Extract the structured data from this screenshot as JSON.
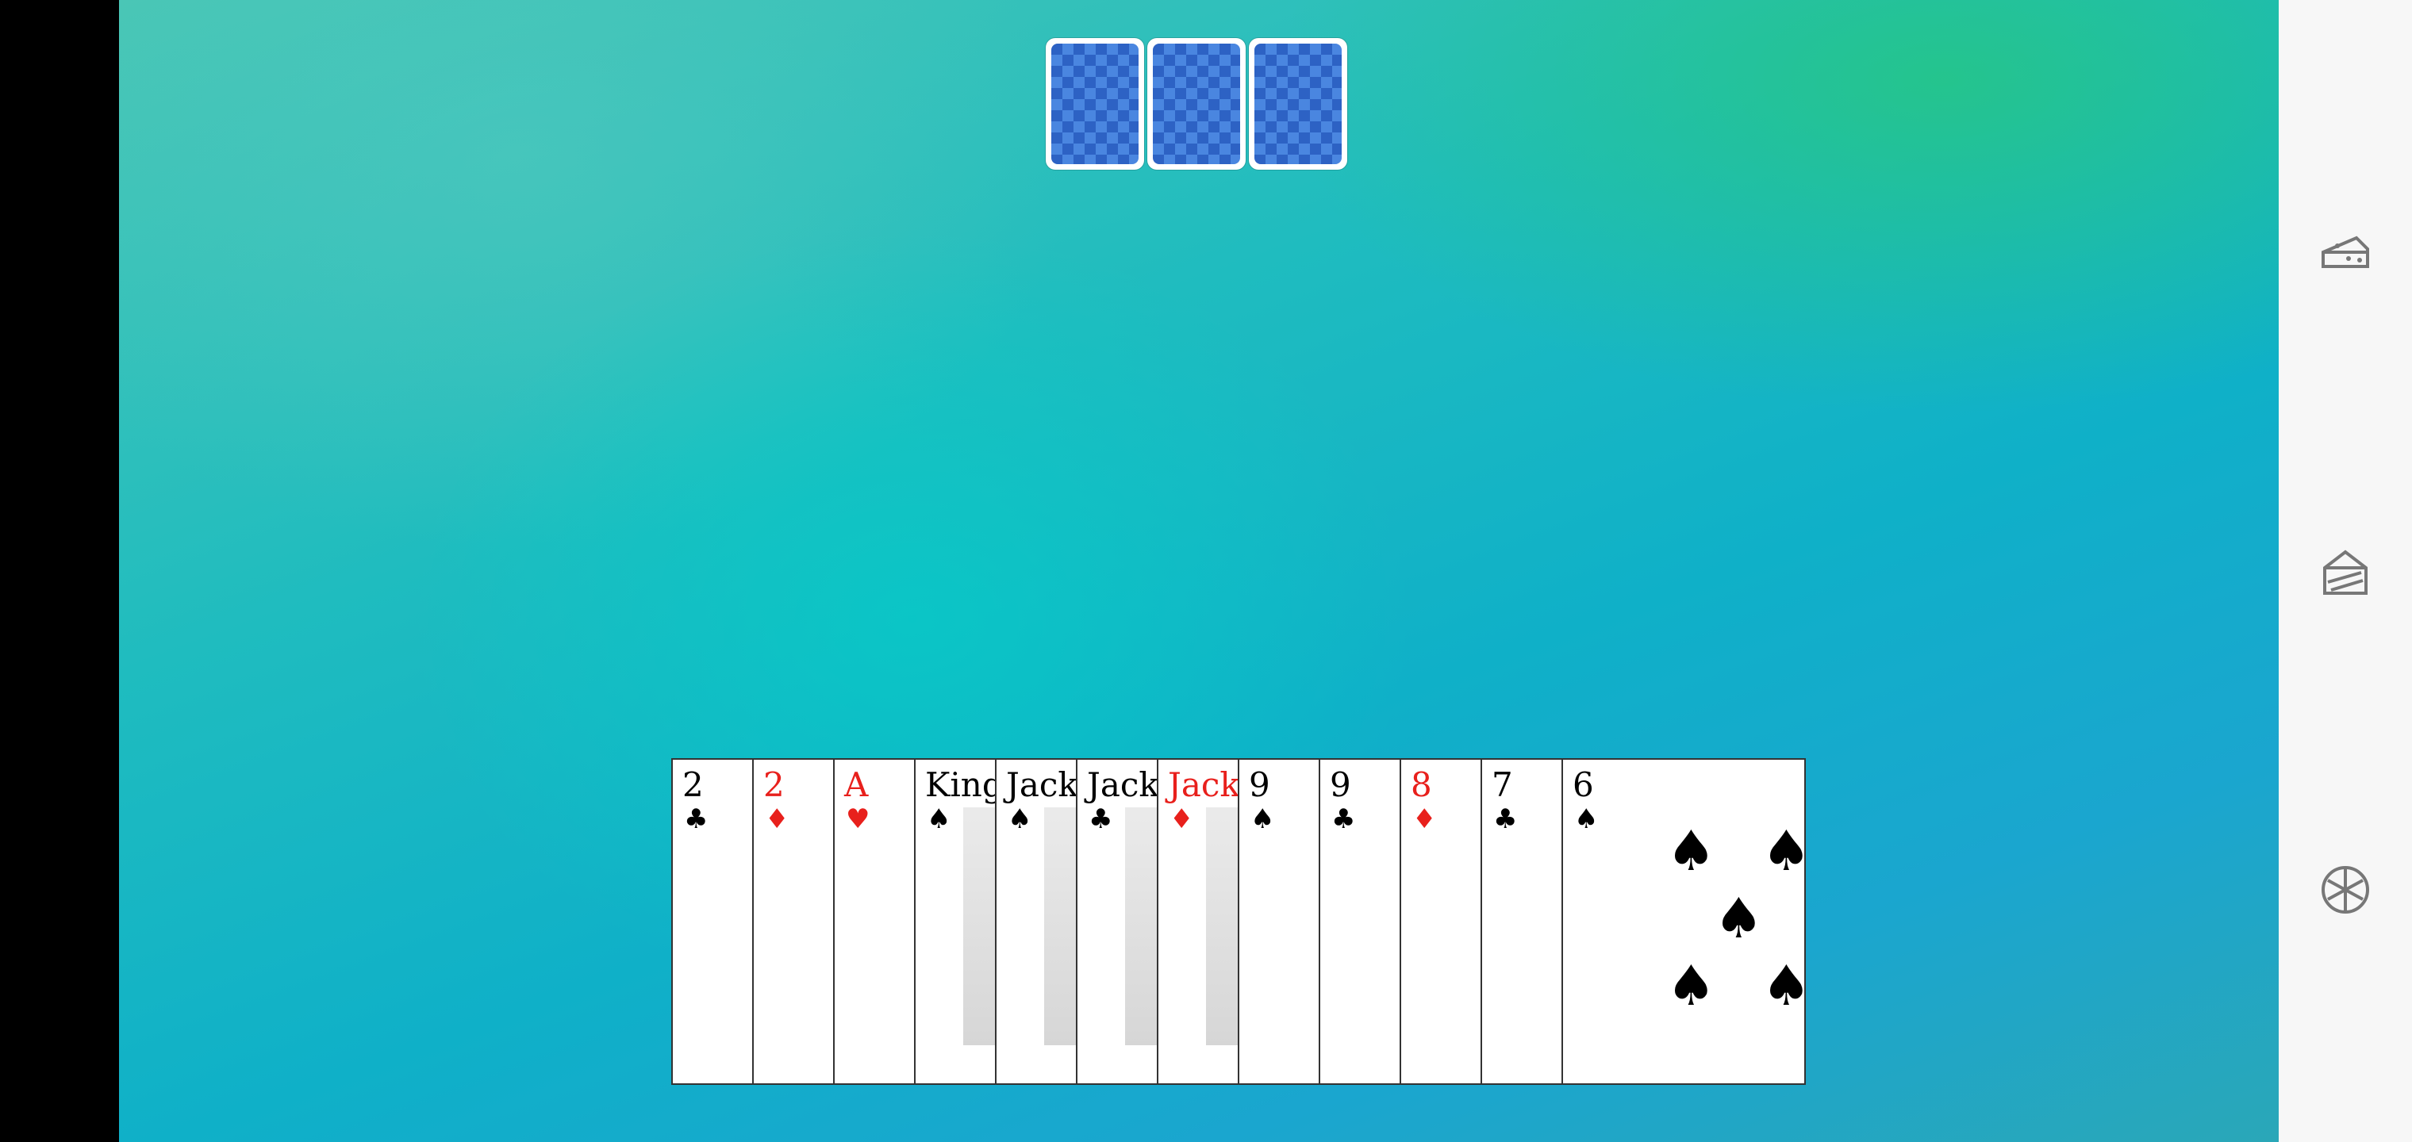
{
  "opponent_cards": {
    "count": 3,
    "back_color": "#2d62c4"
  },
  "hand": [
    {
      "rank": "2",
      "suit": "♣",
      "color": "black"
    },
    {
      "rank": "2",
      "suit": "♦",
      "color": "red"
    },
    {
      "rank": "A",
      "suit": "♥",
      "color": "red"
    },
    {
      "rank": "King",
      "suit": "♠",
      "color": "black"
    },
    {
      "rank": "Jack",
      "suit": "♠",
      "color": "black"
    },
    {
      "rank": "Jack",
      "suit": "♣",
      "color": "black"
    },
    {
      "rank": "Jack",
      "suit": "♦",
      "color": "red"
    },
    {
      "rank": "9",
      "suit": "♠",
      "color": "black"
    },
    {
      "rank": "9",
      "suit": "♣",
      "color": "black"
    },
    {
      "rank": "8",
      "suit": "♦",
      "color": "red"
    },
    {
      "rank": "7",
      "suit": "♣",
      "color": "black"
    },
    {
      "rank": "6",
      "suit": "♠",
      "color": "black"
    }
  ],
  "sidebar": [
    {
      "icon": "cake-slice-icon"
    },
    {
      "icon": "cake-layer-icon"
    },
    {
      "icon": "settings-wheel-icon"
    }
  ]
}
